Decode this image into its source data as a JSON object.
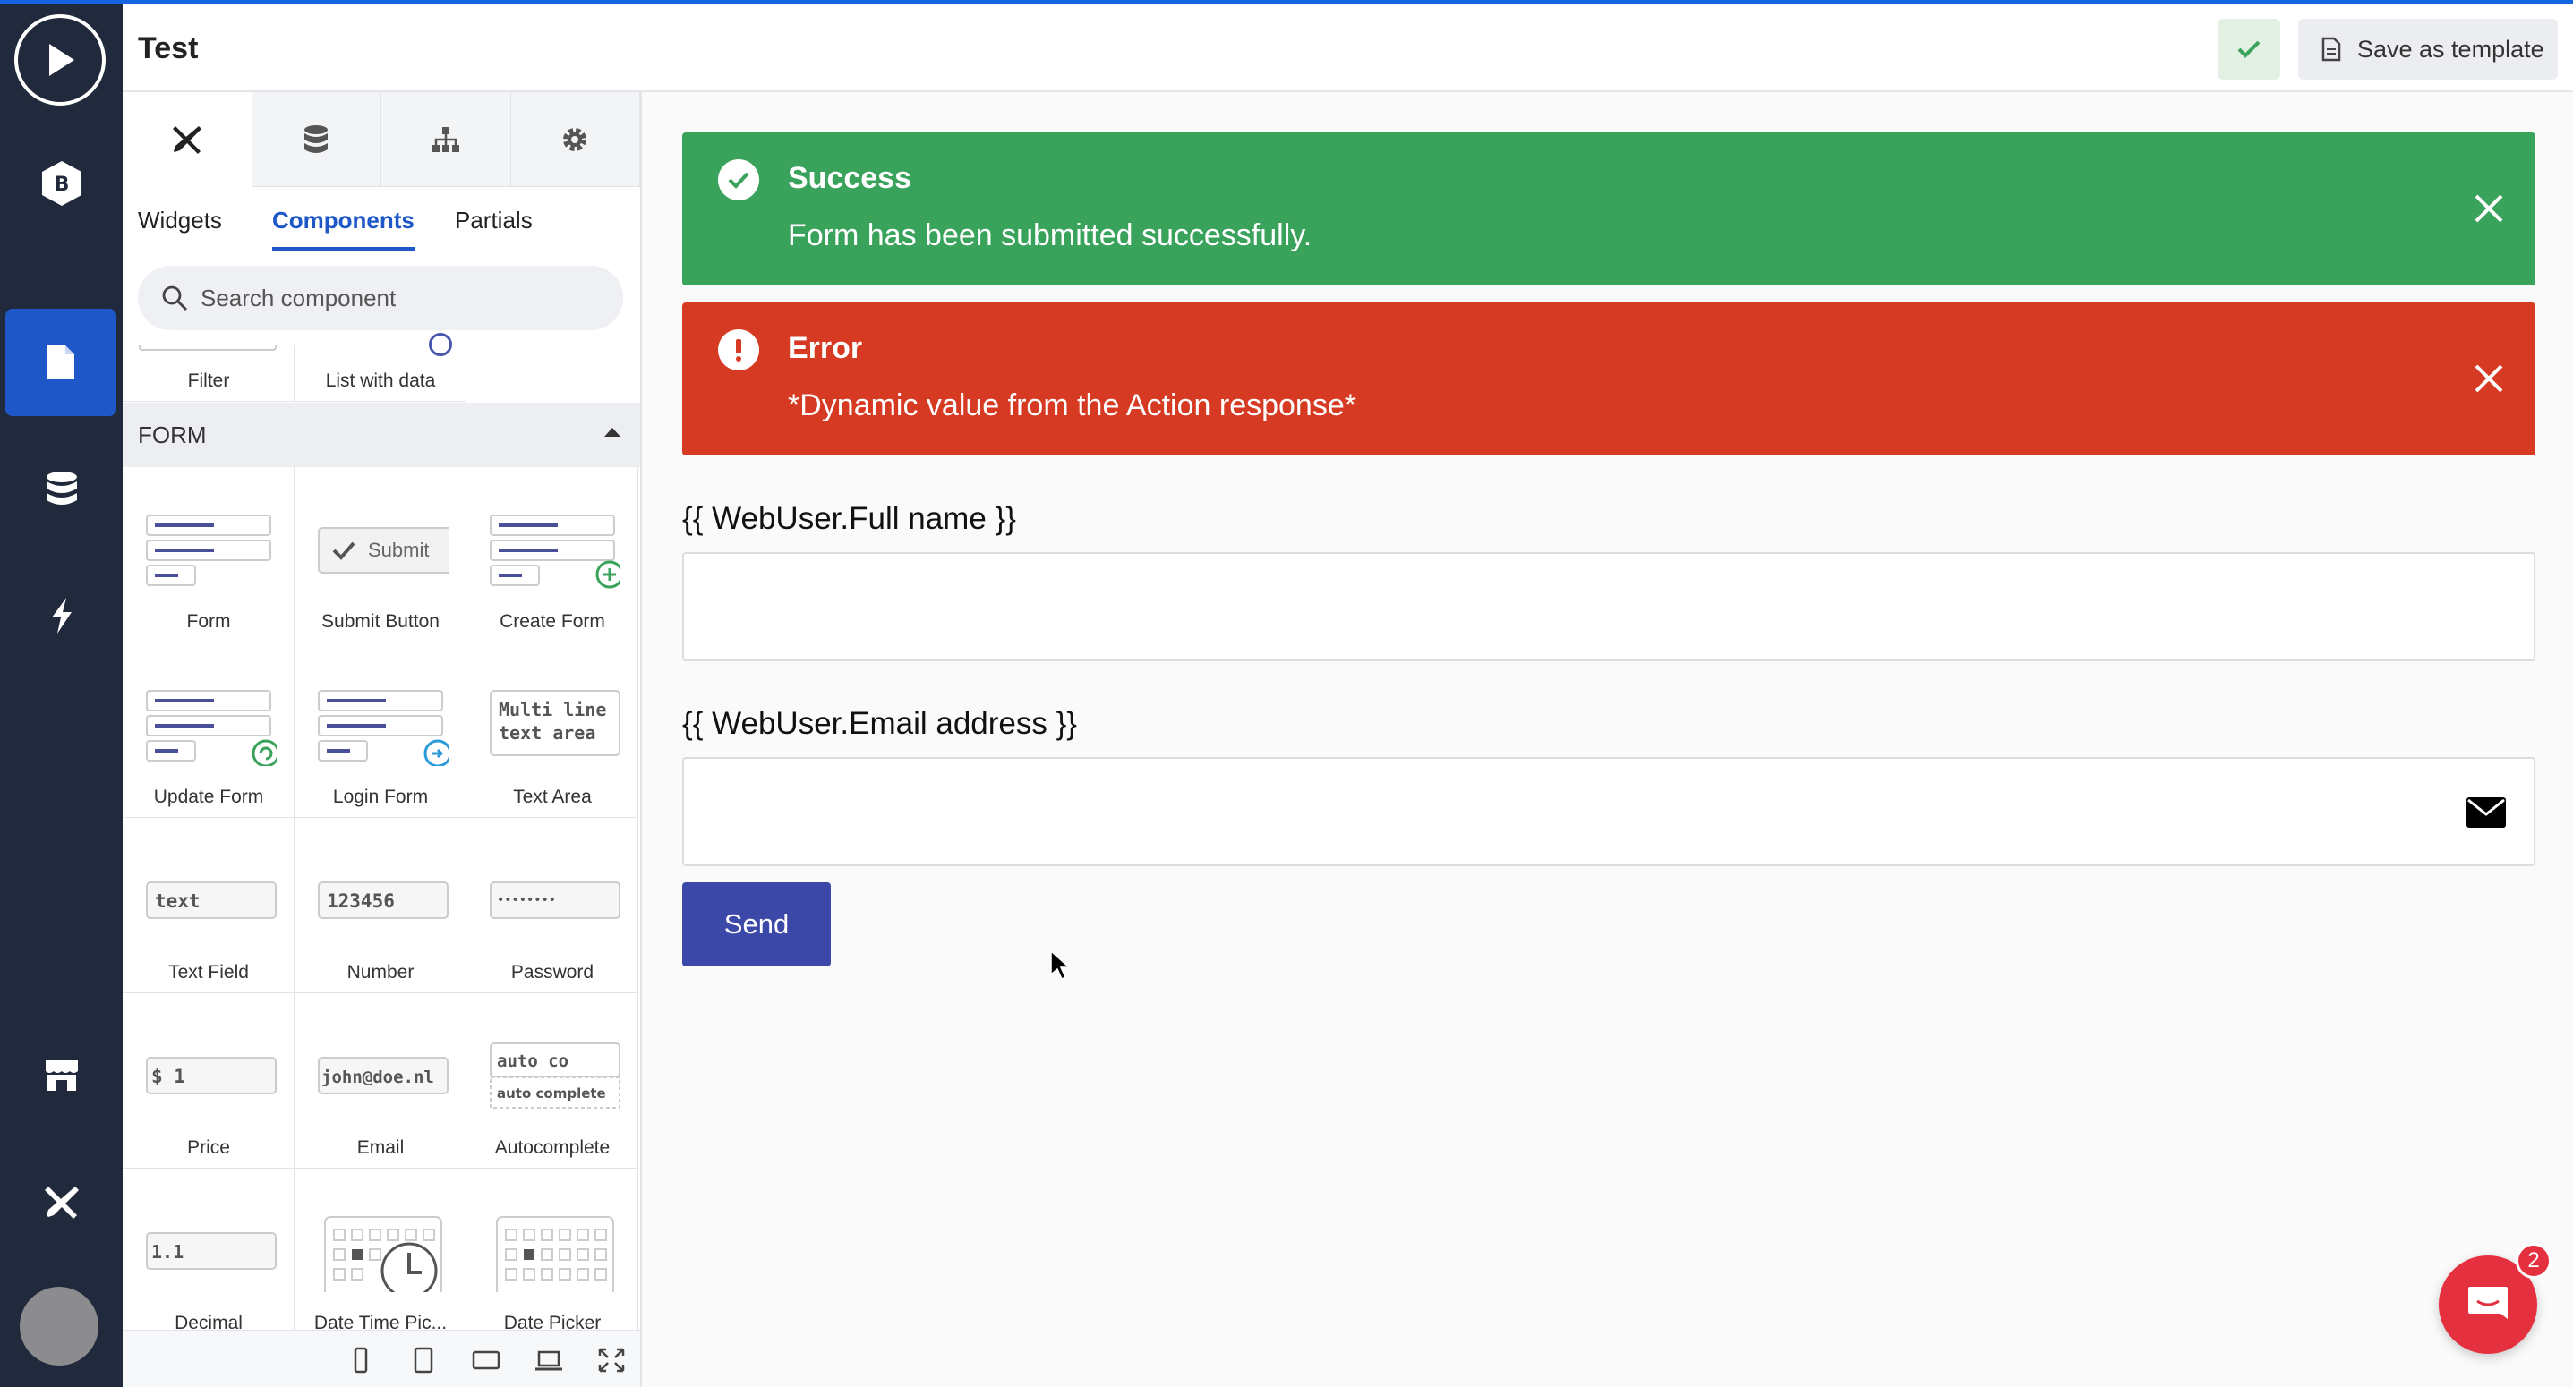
{
  "app": {
    "title": "Test"
  },
  "header": {
    "save_template_label": "Save as template"
  },
  "sidebar": {
    "items": [
      {
        "name": "play-icon"
      },
      {
        "name": "b-logo-icon"
      },
      {
        "name": "page-icon",
        "active": true
      },
      {
        "name": "database-icon"
      },
      {
        "name": "lightning-icon"
      },
      {
        "name": "store-icon"
      },
      {
        "name": "tools-icon"
      }
    ]
  },
  "panel": {
    "top_tabs": [
      "tools-icon",
      "database-icon",
      "hierarchy-icon",
      "gear-icon"
    ],
    "sub_tabs": [
      "Widgets",
      "Components",
      "Partials"
    ],
    "active_sub_tab": "Components",
    "search_placeholder": "Search component",
    "partial_row": [
      "Filter",
      "List with data"
    ],
    "section_title": "FORM",
    "components": [
      "Form",
      "Submit Button",
      "Create Form",
      "Update Form",
      "Login Form",
      "Text Area",
      "Text Field",
      "Number",
      "Password",
      "Price",
      "Email",
      "Autocomplete",
      "Decimal",
      "Date Time Pic...",
      "Date Picker"
    ],
    "icon_texts": {
      "submit": "Submit",
      "multiline": "Multi line",
      "multiline2": "text area",
      "text": "text",
      "number": "123456",
      "password": "••••••••",
      "price": "$ 1",
      "email": "john@doe.nl",
      "autocomplete": "auto co",
      "autocomplete2": "auto complete",
      "decimal": "1.1"
    }
  },
  "canvas": {
    "success": {
      "title": "Success",
      "message": "Form has been submitted successfully."
    },
    "error": {
      "title": "Error",
      "message": "*Dynamic value from the Action response*"
    },
    "fields": [
      {
        "label": "{{ WebUser.Full name }}",
        "value": ""
      },
      {
        "label": "{{ WebUser.Email address }}",
        "value": ""
      }
    ],
    "send_label": "Send"
  },
  "chat": {
    "badge": "2"
  },
  "colors": {
    "accent": "#1e58c8",
    "success": "#3aa35b",
    "error": "#d73a22",
    "button": "#3c48a8",
    "rail": "#202a3c"
  }
}
